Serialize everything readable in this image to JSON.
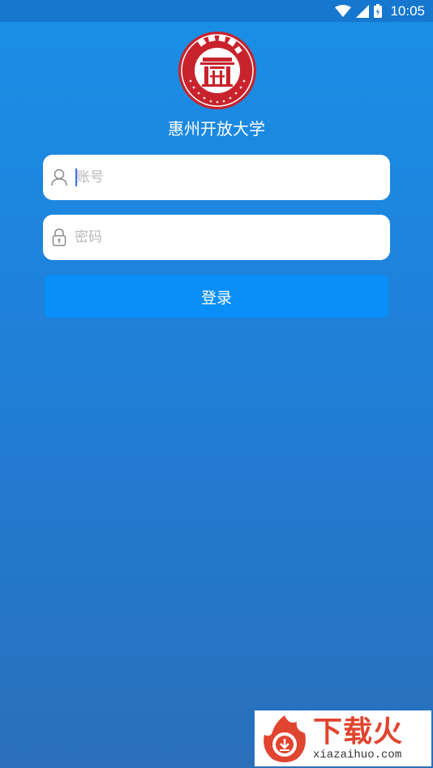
{
  "status_bar": {
    "time": "10:05",
    "icons": [
      "wifi-icon",
      "signal-icon",
      "battery-icon"
    ]
  },
  "header": {
    "logo_name": "school-seal-logo",
    "logo_text": "惠州开放大学 The Open University of Huizhou",
    "school_name": "惠州开放大学"
  },
  "form": {
    "account": {
      "placeholder": "账号",
      "value": "",
      "icon": "user-icon"
    },
    "password": {
      "placeholder": "密码",
      "value": "",
      "icon": "lock-icon"
    },
    "login_label": "登录"
  },
  "watermark": {
    "title": "下载火",
    "subtitle": "xiazaihuo.com"
  },
  "colors": {
    "background_top": "#1a8fe6",
    "background_bottom": "#2a6fba",
    "button": "#0a8ef8",
    "logo_red": "#c8232c",
    "watermark_red": "#e0452f"
  }
}
